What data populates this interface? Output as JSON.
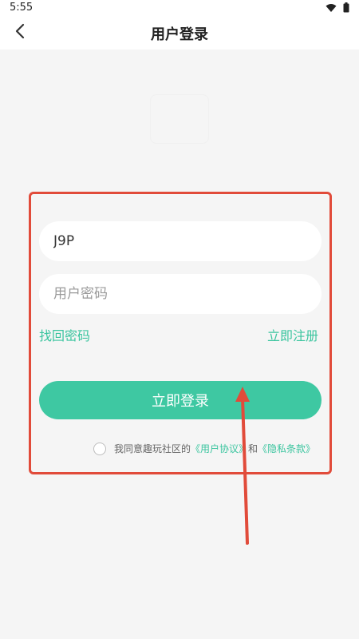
{
  "statusbar": {
    "time": "5:55"
  },
  "header": {
    "title": "用户登录"
  },
  "form": {
    "username_value": "J9P",
    "password_placeholder": "用户密码",
    "forgot_label": "找回密码",
    "register_label": "立即注册",
    "login_label": "立即登录"
  },
  "agreement": {
    "prefix": "我同意趣玩社区的",
    "user_agreement": "《用户协议》",
    "and": "和",
    "privacy_policy": "《隐私条款》"
  },
  "colors": {
    "accent": "#3ec8a2",
    "link": "#3bc59f",
    "annotation_red": "#e14b3a",
    "background": "#f5f5f5"
  },
  "icons": {
    "back": "chevron-left-icon",
    "wifi": "wifi-icon",
    "battery": "battery-icon"
  }
}
